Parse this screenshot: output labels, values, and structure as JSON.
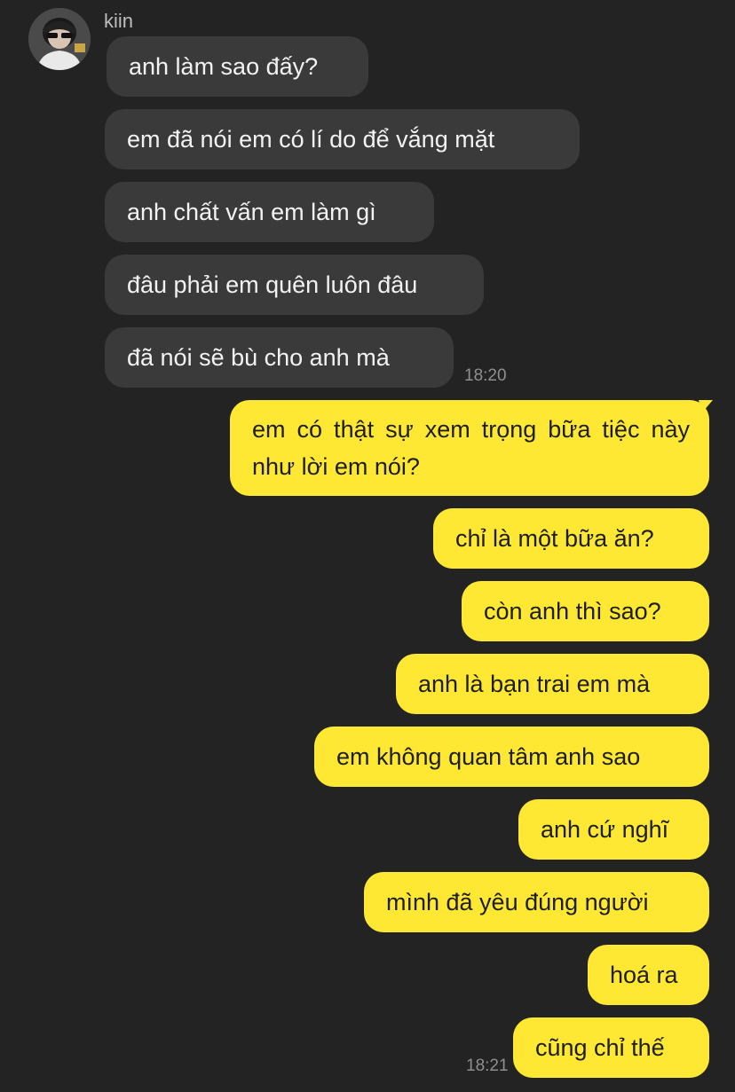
{
  "contact": {
    "name": "kiin",
    "avatar_icon": "profile-photo-icon"
  },
  "colors": {
    "background": "#232323",
    "incoming_bubble": "#3a3a3a",
    "outgoing_bubble": "#fee833",
    "incoming_text": "#f2f2f2",
    "outgoing_text": "#1e1e1e",
    "timestamp": "#8f8f8f"
  },
  "messages": {
    "incoming": [
      "anh làm sao đấy?",
      "em đã nói em có lí do để vắng mặt",
      "anh chất vấn em làm gì",
      "đâu phải em quên luôn đâu",
      "đã nói sẽ bù cho anh mà"
    ],
    "incoming_time": "18:20",
    "outgoing": [
      "em có thật sự xem trọng bữa tiệc này như lời em nói?",
      "chỉ là một bữa ăn?",
      "còn anh thì sao?",
      "anh là bạn trai em mà",
      "em không quan tâm anh sao",
      "anh cứ nghĩ",
      "mình đã yêu đúng người",
      "hoá ra",
      "cũng chỉ thế"
    ],
    "outgoing_time": "18:21"
  }
}
